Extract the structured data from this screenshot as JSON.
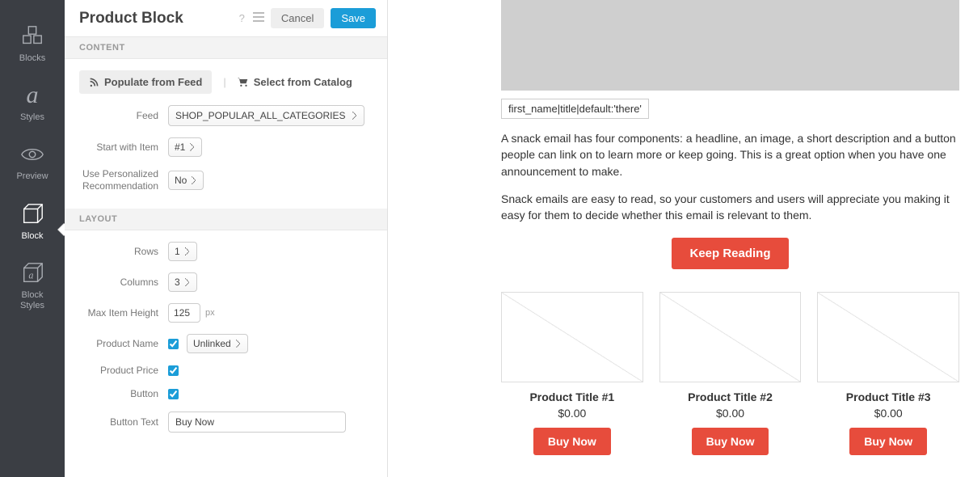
{
  "nav": {
    "items": [
      {
        "id": "blocks",
        "label": "Blocks"
      },
      {
        "id": "styles",
        "label": "Styles"
      },
      {
        "id": "preview",
        "label": "Preview"
      },
      {
        "id": "block",
        "label": "Block"
      },
      {
        "id": "block-styles",
        "label": "Block\nStyles"
      }
    ]
  },
  "panel": {
    "title": "Product Block",
    "cancel": "Cancel",
    "save": "Save",
    "content_label": "CONTENT",
    "layout_label": "LAYOUT",
    "populate_label": "Populate from Feed",
    "select_catalog_label": "Select from Catalog",
    "feed_label": "Feed",
    "feed_value": "SHOP_POPULAR_ALL_CATEGORIES",
    "start_item_label": "Start with Item",
    "start_item_value": "#1",
    "personalized_label": "Use Personalized Recommendation",
    "personalized_value": "No",
    "rows_label": "Rows",
    "rows_value": "1",
    "columns_label": "Columns",
    "columns_value": "3",
    "max_height_label": "Max Item Height",
    "max_height_value": "125",
    "max_height_unit": "px",
    "product_name_label": "Product Name",
    "product_name_link": "Unlinked",
    "product_price_label": "Product Price",
    "button_label": "Button",
    "button_text_label": "Button Text",
    "button_text_value": "Buy Now"
  },
  "preview": {
    "merge_tag": "first_name|title|default:'there'",
    "para1": "A snack email has four components: a headline, an image, a short description and a button people can link on to learn more or keep going. This is a great option when you have one announcement to make.",
    "para2": "Snack emails are easy to read, so your customers and users will appreciate you making it easy for them to decide whether this email is relevant to them.",
    "cta": "Keep Reading",
    "products": [
      {
        "title": "Product Title #1",
        "price": "$0.00",
        "btn": "Buy Now"
      },
      {
        "title": "Product Title #2",
        "price": "$0.00",
        "btn": "Buy Now"
      },
      {
        "title": "Product Title #3",
        "price": "$0.00",
        "btn": "Buy Now"
      }
    ]
  }
}
